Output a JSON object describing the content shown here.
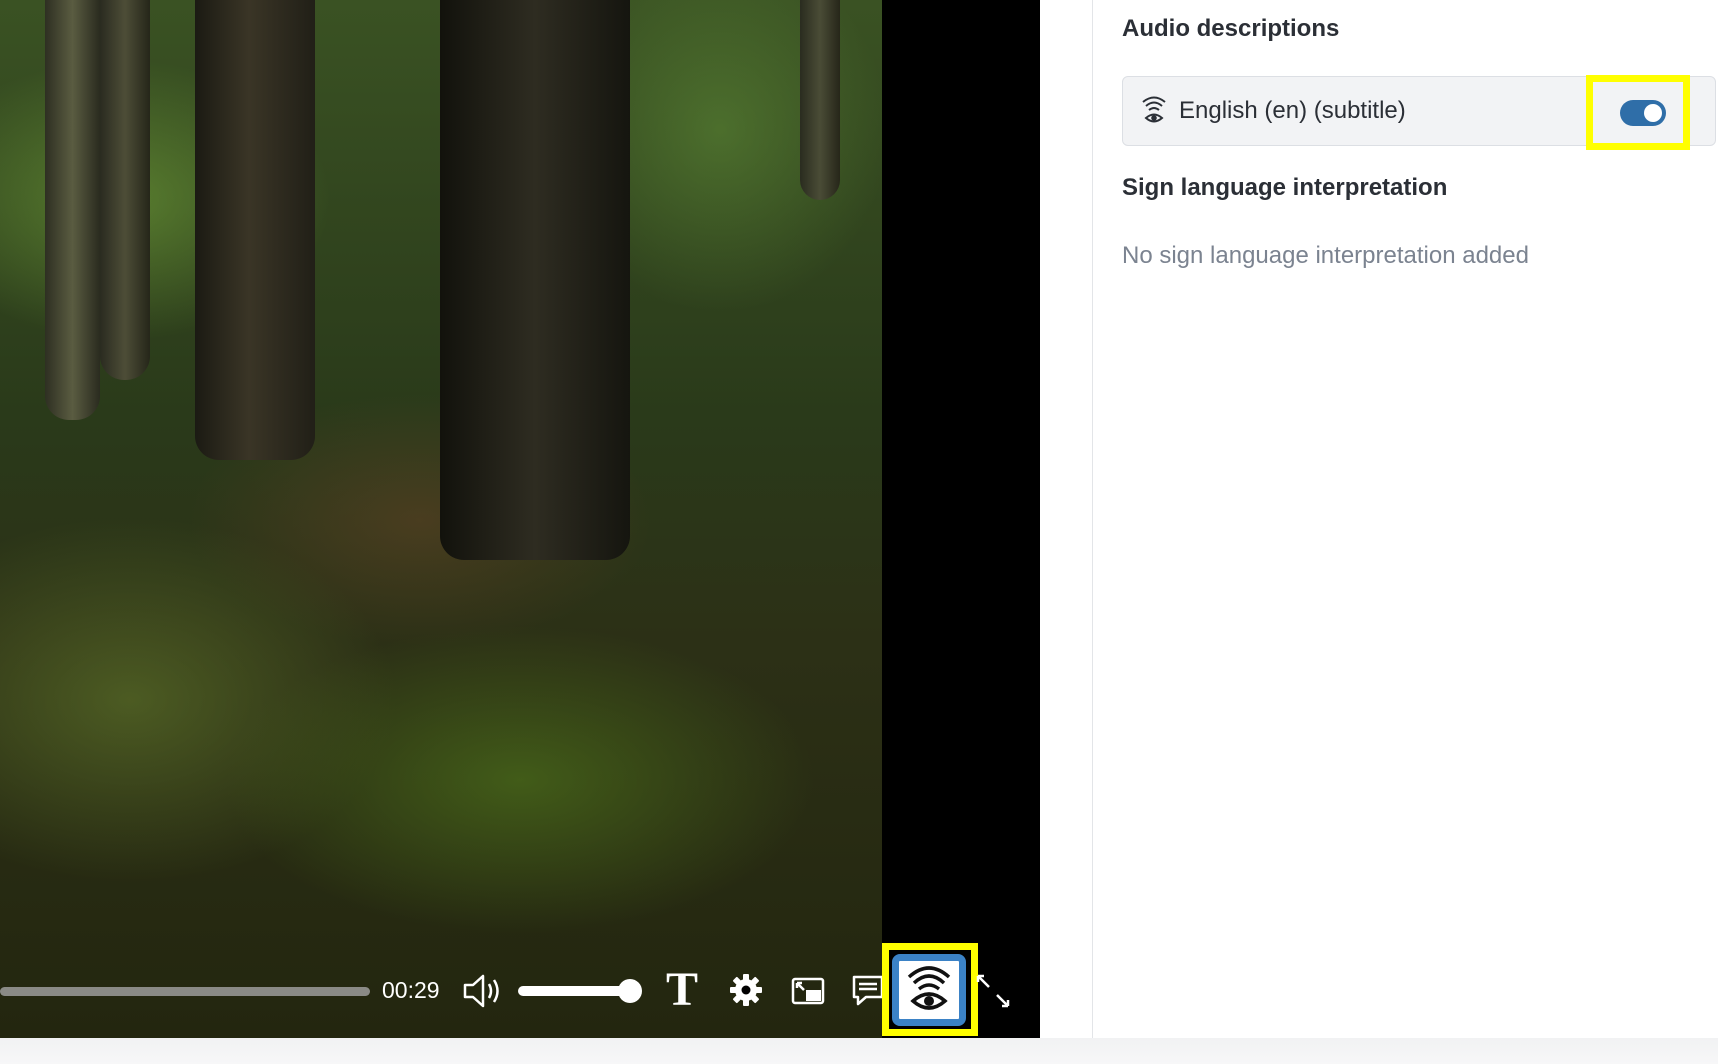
{
  "player": {
    "current_time": "00:29",
    "volume_level": 1.0,
    "text_icon_glyph": "T",
    "icons": [
      "volume-icon",
      "text-style-icon",
      "gear-icon",
      "picture-in-picture-icon",
      "captions-icon",
      "audio-description-icon",
      "fullscreen-icon"
    ]
  },
  "panel": {
    "audio_descriptions": {
      "heading": "Audio descriptions",
      "track_label": "English (en) (subtitle)",
      "enabled": true
    },
    "sign_language": {
      "heading": "Sign language interpretation",
      "empty_text": "No sign language interpretation added"
    }
  },
  "colors": {
    "highlight": "#ffff00",
    "accent": "#2f6ea8",
    "ad_button_border": "#3b82c6"
  }
}
